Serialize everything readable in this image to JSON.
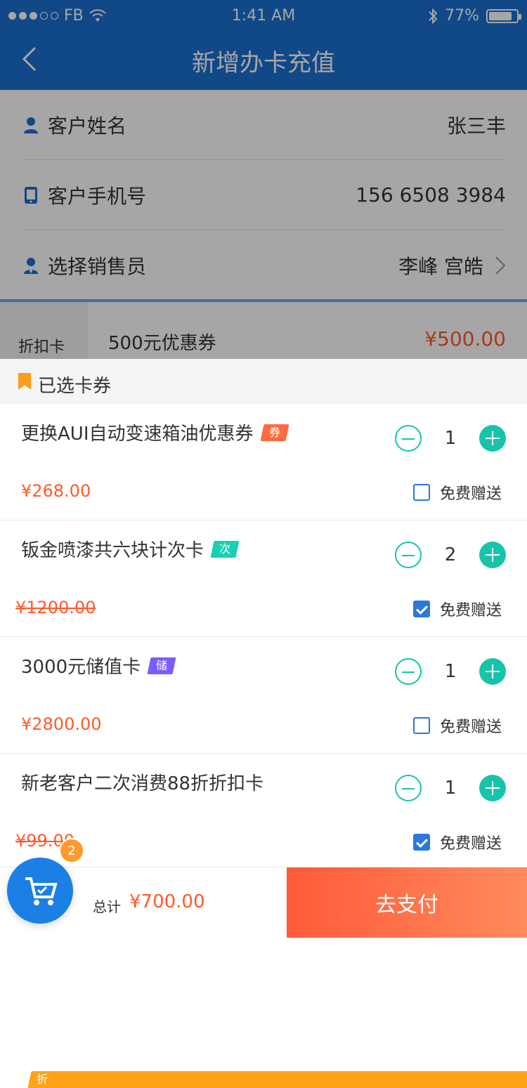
{
  "status": {
    "carrier": "FB",
    "time": "1:41 AM",
    "battery": "77%",
    "battery_level": 0.77
  },
  "nav": {
    "title": "新增办卡充值"
  },
  "info": {
    "rows": [
      {
        "label": "客户姓名",
        "value": "张三丰"
      },
      {
        "label": "客户手机号",
        "value": "156 6508 3984"
      },
      {
        "label": "选择销售员",
        "value": "李峰  宫皓"
      }
    ]
  },
  "discount": {
    "side_label": "折扣卡",
    "name": "500元优惠券",
    "price": "¥500.00"
  },
  "sheet": {
    "title": "已选卡券",
    "items": [
      {
        "name": "更换AUI自动变速箱油优惠券",
        "tag": "券",
        "qty": "1",
        "price": "¥268.00",
        "gift_label": "免费赠送",
        "gift_checked": false
      },
      {
        "name": "钣金喷漆共六块计次卡",
        "tag": "次",
        "qty": "2",
        "price": "¥1200.00",
        "gift_label": "免费赠送",
        "gift_checked": true
      },
      {
        "name": "3000元储值卡",
        "tag": "储",
        "qty": "1",
        "price": "¥2800.00",
        "gift_label": "免费赠送",
        "gift_checked": false
      },
      {
        "name": "新老客户二次消费88折折扣卡",
        "tag": "折",
        "qty": "1",
        "price": "¥99.00",
        "gift_label": "免费赠送",
        "gift_checked": true
      }
    ]
  },
  "bottom": {
    "cart_count": "2",
    "total_label": "总计",
    "total_value": "¥700.00",
    "pay_label": "去支付"
  },
  "colors": {
    "primary": "#1b6fd1",
    "accent": "#18c4a9",
    "price": "#ff5a2a"
  }
}
